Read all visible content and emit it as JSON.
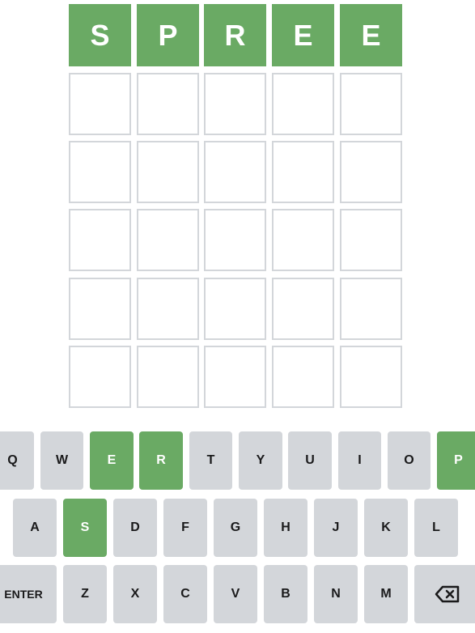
{
  "board": {
    "rows": [
      [
        "S",
        "P",
        "R",
        "E",
        "E"
      ],
      [
        "",
        "",
        "",
        "",
        ""
      ],
      [
        "",
        "",
        "",
        "",
        ""
      ],
      [
        "",
        "",
        "",
        "",
        ""
      ],
      [
        "",
        "",
        "",
        "",
        ""
      ],
      [
        "",
        "",
        "",
        "",
        ""
      ]
    ]
  },
  "keyboard": {
    "row1": [
      {
        "label": "Q",
        "state": "unused"
      },
      {
        "label": "W",
        "state": "unused"
      },
      {
        "label": "E",
        "state": "correct"
      },
      {
        "label": "R",
        "state": "correct"
      },
      {
        "label": "T",
        "state": "unused"
      },
      {
        "label": "Y",
        "state": "unused"
      },
      {
        "label": "U",
        "state": "unused"
      },
      {
        "label": "I",
        "state": "unused"
      },
      {
        "label": "O",
        "state": "unused"
      },
      {
        "label": "P",
        "state": "correct"
      }
    ],
    "row2": [
      {
        "label": "A",
        "state": "unused"
      },
      {
        "label": "S",
        "state": "correct"
      },
      {
        "label": "D",
        "state": "unused"
      },
      {
        "label": "F",
        "state": "unused"
      },
      {
        "label": "G",
        "state": "unused"
      },
      {
        "label": "H",
        "state": "unused"
      },
      {
        "label": "J",
        "state": "unused"
      },
      {
        "label": "K",
        "state": "unused"
      },
      {
        "label": "L",
        "state": "unused"
      }
    ],
    "row3": [
      {
        "label": "ENTER",
        "state": "unused"
      },
      {
        "label": "Z",
        "state": "unused"
      },
      {
        "label": "X",
        "state": "unused"
      },
      {
        "label": "C",
        "state": "unused"
      },
      {
        "label": "V",
        "state": "unused"
      },
      {
        "label": "B",
        "state": "unused"
      },
      {
        "label": "N",
        "state": "unused"
      },
      {
        "label": "M",
        "state": "unused"
      },
      {
        "label": "",
        "icon": "backspace-icon",
        "state": "unused"
      }
    ]
  },
  "colors": {
    "correct": "#6aaa64",
    "key_default": "#d3d6da",
    "tile_border": "#d3d6da"
  }
}
